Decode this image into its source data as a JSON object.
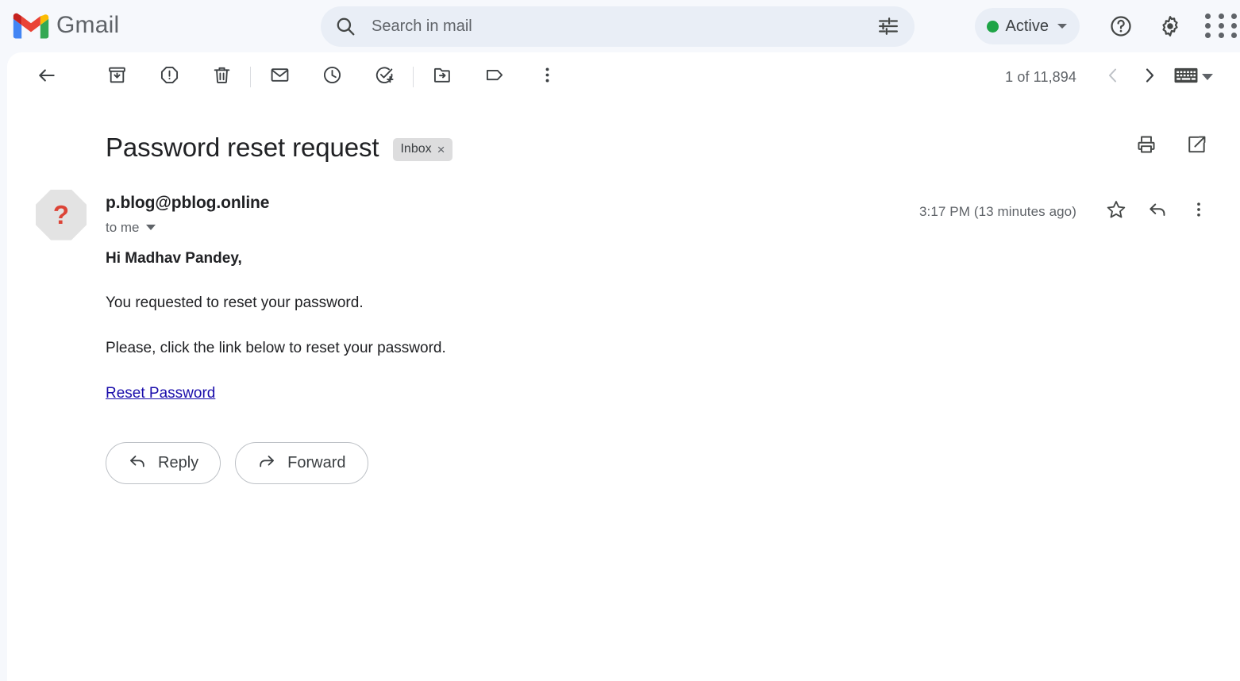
{
  "app": {
    "brand_name": "Gmail",
    "logo_icon": "gmail-logo"
  },
  "search": {
    "placeholder": "Search in mail",
    "value": "",
    "search_icon": "search-icon",
    "filter_icon": "filter-options-icon"
  },
  "header": {
    "status_label": "Active",
    "status_color": "#1ea446",
    "help_icon": "help-circle-icon",
    "settings_icon": "gear-icon",
    "apps_icon": "apps-grid-icon"
  },
  "toolbar": {
    "back_label": "Back to Inbox",
    "archive_label": "Archive",
    "spam_label": "Report spam",
    "delete_label": "Delete",
    "unread_label": "Mark as unread",
    "snooze_label": "Snooze",
    "task_label": "Add to tasks",
    "move_label": "Move to",
    "labels_label": "Labels",
    "more_label": "More",
    "page_count": "1 of 11,894",
    "prev_label": "Older",
    "next_label": "Newer",
    "keyboard_label": "Select input tool"
  },
  "email": {
    "subject": "Password reset request",
    "label_chip": "Inbox",
    "label_chip_remove": "×",
    "print_label": "Print all",
    "popout_label": "Open in new window",
    "sender": "p.blog@pblog.online",
    "recipient": "to me",
    "avatar_glyph": "?",
    "avatar_icon": "unknown-sender-octagon-icon",
    "timestamp": "3:17 PM (13 minutes ago)",
    "star_label": "Star",
    "reply_icon_label": "Reply",
    "more_options_label": "More",
    "body": {
      "greeting": "Hi Madhav Pandey,",
      "paragraph_1": "You requested to reset your password.",
      "paragraph_2": "Please, click the link below to reset your password.",
      "link_text": "Reset Password"
    },
    "actions": {
      "reply": "Reply",
      "forward": "Forward"
    }
  },
  "colors": {
    "header_bg": "#f6f8fc",
    "search_bg": "#e9eef6",
    "panel_bg": "#ffffff",
    "link": "#1a0dab",
    "chip_bg": "#ddddde",
    "avatar_bg": "#e3e3e3",
    "avatar_glyph_color": "#dc4437"
  }
}
